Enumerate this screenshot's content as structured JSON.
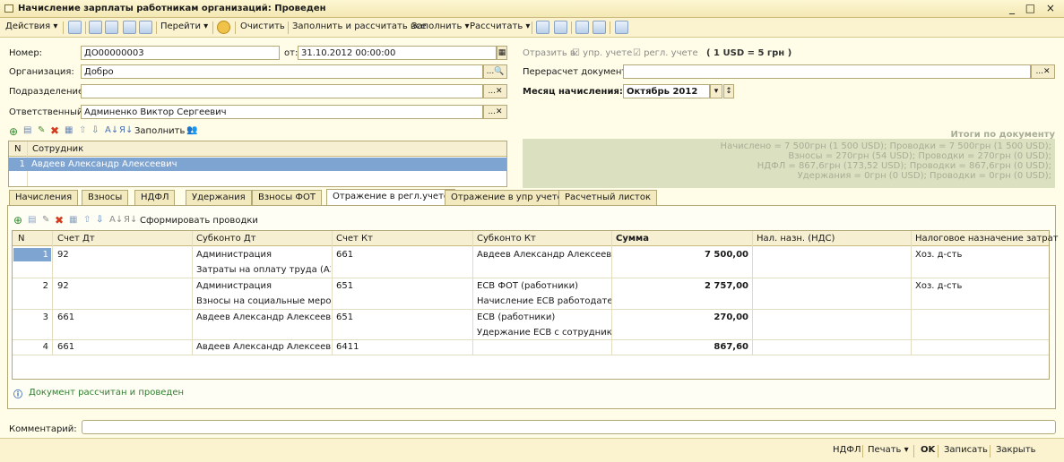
{
  "window": {
    "title": "Начисление зарплаты работникам организаций: Проведен",
    "controls": "_ □ ×"
  },
  "toolbar": {
    "actions": "Действия ▾",
    "goto": "Перейти ▾",
    "clear": "Очистить",
    "fill_calc_all": "Заполнить и рассчитать все",
    "fill": "Заполнить ▾",
    "calculate": "Рассчитать ▾"
  },
  "form": {
    "number_label": "Номер:",
    "number_value": "ДО00000003",
    "date_label": "от:",
    "date_value": "31.10.2012 00:00:00",
    "org_label": "Организация:",
    "org_value": "Добро",
    "dept_label": "Подразделение:",
    "dept_value": "",
    "resp_label": "Ответственный:",
    "resp_value": "Админенко Виктор Сергеевич",
    "reflect_label": "Отразить в:",
    "reflect_mgmt": "упр. учете",
    "reflect_reg": "регл. учете",
    "rate": "( 1 USD = 5 грн )",
    "recalc_label": "Перерасчет документа:",
    "recalc_value": "",
    "month_label": "Месяц начисления:",
    "month_value": "Октябрь 2012"
  },
  "employees": {
    "toolbar_fill": "Заполнить ▾",
    "header_n": "N",
    "header_employee": "Сотрудник",
    "rows": [
      {
        "n": "1",
        "name": "Авдеев Александр Алексеевич"
      }
    ]
  },
  "totals": {
    "title": "Итоги по документу",
    "lines": [
      "Начислено = 7 500грн (1 500 USD);   Проводки = 7 500грн (1 500 USD);",
      "Взносы = 270грн (54 USD);   Проводки = 270грн (0 USD);",
      "НДФЛ = 867,6грн (173,52 USD);   Проводки = 867,6грн (0 USD);",
      "Удержания = 0грн (0 USD);   Проводки = 0грн (0 USD);"
    ]
  },
  "tabs": [
    "Начисления",
    "Взносы",
    "НДФЛ",
    "Удержания",
    "Взносы ФОТ",
    "Отражение в регл.учете",
    "Отражение в упр учете",
    "Расчетный листок"
  ],
  "entries": {
    "toolbar_generate": "Сформировать проводки",
    "columns": [
      "N",
      "Счет Дт",
      "Субконто Дт",
      "Счет Кт",
      "Субконто Кт",
      "Сумма",
      "Нал. назн. (НДС)",
      "Налоговое назначение затрат"
    ],
    "rows": [
      {
        "n": "1",
        "debit": "92",
        "sub_dt1": "Администрация",
        "sub_dt2": "Затраты на оплату труда (АЗ)",
        "credit": "661",
        "sub_kt1": "Авдеев Александр Алексеевич",
        "sub_kt2": "",
        "amount": "7 500,00",
        "vat": "",
        "tax_purpose": "Хоз. д-сть"
      },
      {
        "n": "2",
        "debit": "92",
        "sub_dt1": "Администрация",
        "sub_dt2": "Взносы на социальные мероп...",
        "credit": "651",
        "sub_kt1": "ЕСВ ФОТ (работники)",
        "sub_kt2": "Начисление ЕСВ работодател...",
        "amount": "2 757,00",
        "vat": "",
        "tax_purpose": "Хоз. д-сть"
      },
      {
        "n": "3",
        "debit": "661",
        "sub_dt1": "Авдеев Александр Алексеевич",
        "sub_dt2": "",
        "credit": "651",
        "sub_kt1": "ЕСВ (работники)",
        "sub_kt2": "Удержание ЕСВ с сотруднико...",
        "amount": "270,00",
        "vat": "",
        "tax_purpose": ""
      },
      {
        "n": "4",
        "debit": "661",
        "sub_dt1": "Авдеев Александр Алексеевич",
        "sub_dt2": "",
        "credit": "6411",
        "sub_kt1": "",
        "sub_kt2": "",
        "amount": "867,60",
        "vat": "",
        "tax_purpose": ""
      }
    ]
  },
  "status": "Документ рассчитан и проведен",
  "comment_label": "Комментарий:",
  "comment_value": "",
  "footer": {
    "ndfl": "НДФЛ",
    "print": "Печать ▾",
    "ok": "OK",
    "save": "Записать",
    "close": "Закрыть"
  }
}
